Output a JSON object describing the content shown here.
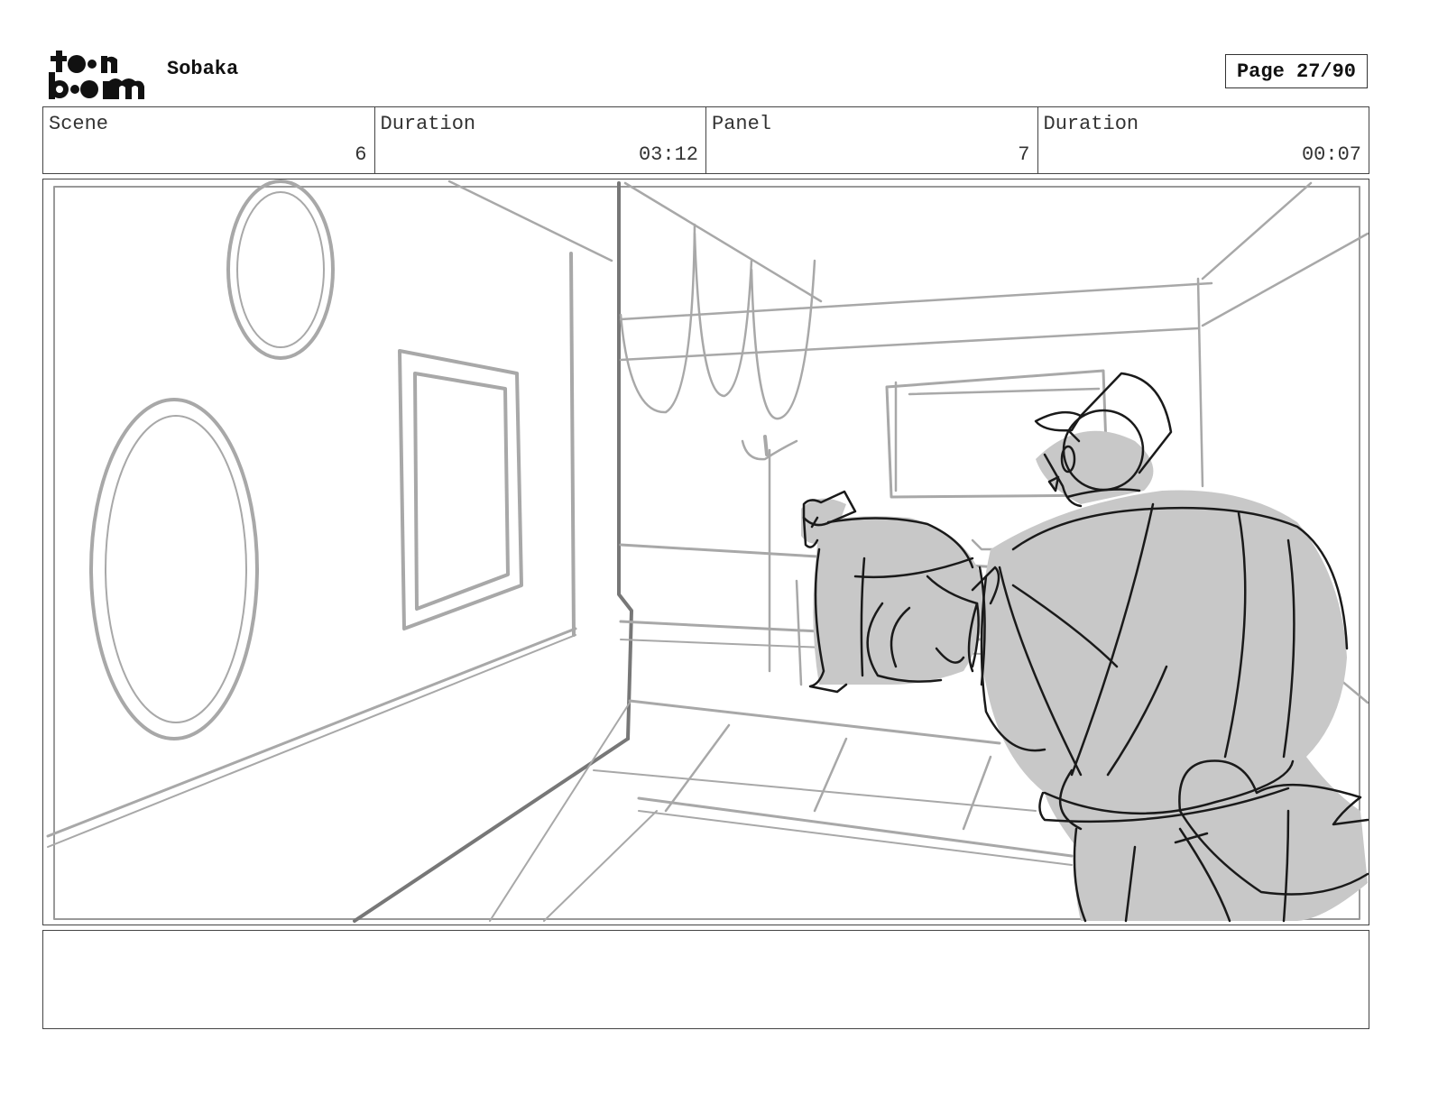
{
  "header": {
    "logo_name": "toon-boom-logo",
    "logo_text_top": "to•n",
    "logo_text_bottom": "b••m",
    "project_title": "Sobaka",
    "page_label": "Page 27/90"
  },
  "info": {
    "scene_label": "Scene",
    "scene_value": "6",
    "scene_duration_label": "Duration",
    "scene_duration_value": "03:12",
    "panel_label": "Panel",
    "panel_value": "7",
    "panel_duration_label": "Duration",
    "panel_duration_value": "00:07"
  },
  "notes": {
    "text": ""
  },
  "colors": {
    "sketch_gray": "#a8a8a8",
    "sketch_dark": "#1a1a1a",
    "fill_gray": "#c8c8c8"
  }
}
